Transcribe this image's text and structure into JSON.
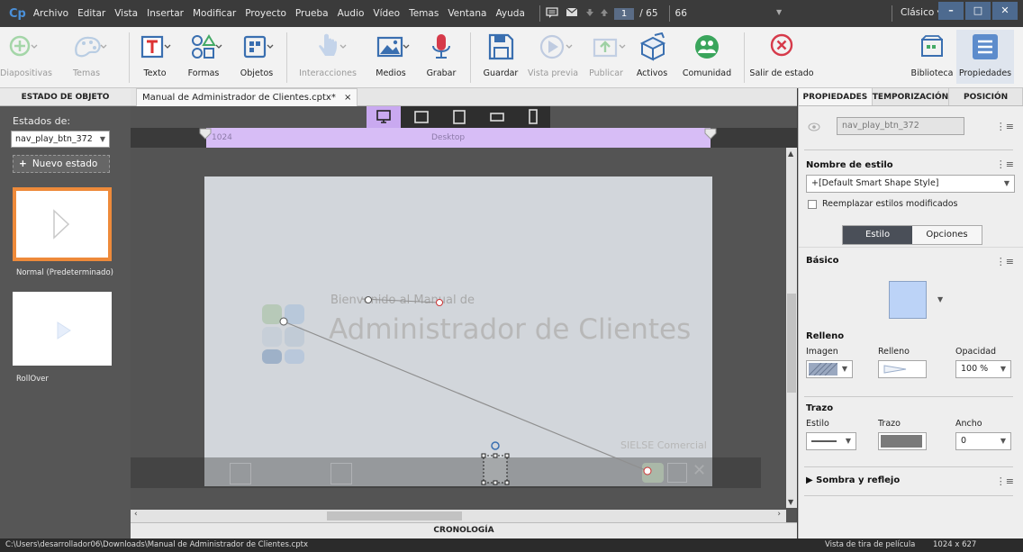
{
  "app": {
    "logo": "Cp",
    "menu": [
      "Archivo",
      "Editar",
      "Vista",
      "Insertar",
      "Modificar",
      "Proyecto",
      "Prueba",
      "Audio",
      "Vídeo",
      "Temas",
      "Ventana",
      "Ayuda"
    ],
    "slide_current": "1",
    "slide_sep": "/ 65",
    "slide_total": "66",
    "workspace": "Clásico",
    "win_minimize": "–",
    "win_maximize": "□",
    "win_close": "✕"
  },
  "toolbar": {
    "diapositivas": "Diapositivas",
    "temas": "Temas",
    "texto": "Texto",
    "formas": "Formas",
    "objetos": "Objetos",
    "interacciones": "Interacciones",
    "medios": "Medios",
    "grabar": "Grabar",
    "guardar": "Guardar",
    "vista_previa": "Vista previa",
    "publicar": "Publicar",
    "activos": "Activos",
    "comunidad": "Comunidad",
    "salir_estado": "Salir de estado",
    "biblioteca": "Biblioteca",
    "propiedades": "Propiedades"
  },
  "left_panel": {
    "header": "ESTADO DE OBJETO",
    "estados_label": "Estados de:",
    "object_name": "nav_play_btn_372",
    "new_state": "Nuevo estado",
    "states": [
      {
        "name": "Normal (Predeterminado)"
      },
      {
        "name": "RollOver"
      }
    ]
  },
  "document": {
    "tab": "Manual de Administrador de Clientes.cptx*",
    "tab_close": "×",
    "breakpoint_left": "1024",
    "breakpoint_center": "Desktop",
    "slide_title_small": "Bienvenido al Manual de",
    "slide_title_big": "Administrador de Clientes",
    "slide_footer": "SIELSE Comercial",
    "timeline": "CRONOLOGÍA"
  },
  "right_panel": {
    "tabs": [
      "PROPIEDADES",
      "TEMPORIZACIÓN",
      "POSICIÓN"
    ],
    "object_name": "nav_play_btn_372",
    "style_name_label": "Nombre de estilo",
    "style_value": "+[Default Smart Shape Style]",
    "override_label": "Reemplazar estilos modificados",
    "subtab_style": "Estilo",
    "subtab_options": "Opciones",
    "basic_label": "Básico",
    "fill_label": "Relleno",
    "image_label": "Imagen",
    "fill_sub_label": "Relleno",
    "opacity_label": "Opacidad",
    "opacity_value": "100 %",
    "stroke_label": "Trazo",
    "stroke_style_label": "Estilo",
    "stroke_stroke_label": "Trazo",
    "stroke_width_label": "Ancho",
    "stroke_width_value": "0",
    "shadow_label": "Sombra y reflejo"
  },
  "status": {
    "path": "C:\\Users\\desarrollador06\\Downloads\\Manual de Administrador de Clientes.cptx",
    "view": "Vista de tira de película",
    "resolution": "1024 x 627"
  },
  "colors": {
    "accent": "#4a90d9",
    "selected_state_border": "#ee8a3a",
    "breakpoint": "#d7bdf6",
    "device_active": "#c9a9f0",
    "shape_fill": "#bcd3f7"
  }
}
